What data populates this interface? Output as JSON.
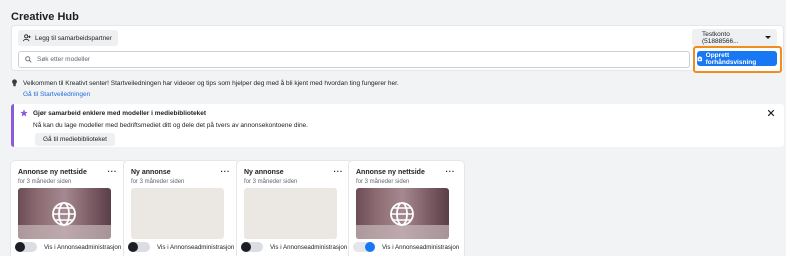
{
  "page": {
    "title": "Creative Hub"
  },
  "toolbar": {
    "partner_button": "Legg til samarbeidspartner",
    "account_select": "Testkonto (51888566...",
    "search_placeholder": "Søk etter modeller",
    "create_button": "Opprett forhåndsvisning"
  },
  "welcome": {
    "text": "Velkommen til Kreativt senter! Startveiledningen har videoer og tips som hjelper deg med å bli kjent med hvordan ting fungerer her.",
    "link": "Gå til Startveiledningen"
  },
  "banner": {
    "title": "Gjør samarbeid enklere med modeller i mediebiblioteket",
    "text": "Nå kan du lage modeller med bedriftsmediet ditt og dele det på tvers av annonsekontoene dine.",
    "button": "Gå til mediebiblioteket"
  },
  "cards": [
    {
      "title": "Annonse ny nettside",
      "subtitle": "for 3 måneder siden",
      "thumbnail": "globe-image",
      "toggle_label": "Vis i Annonseadministrasjon",
      "toggle_on": false
    },
    {
      "title": "Ny annonse",
      "subtitle": "for 3 måneder siden",
      "thumbnail": "placeholder",
      "toggle_label": "Vis i Annonseadministrasjon",
      "toggle_on": false
    },
    {
      "title": "Ny annonse",
      "subtitle": "for 3 måneder siden",
      "thumbnail": "placeholder",
      "toggle_label": "Vis i Annonseadministrasjon",
      "toggle_on": false
    },
    {
      "title": "Annonse ny nettside",
      "subtitle": "for 3 måneder siden",
      "thumbnail": "globe-image",
      "toggle_label": "Vis i Annonseadministrasjon",
      "toggle_on": true
    }
  ],
  "colors": {
    "accent": "#1877f2",
    "highlight": "#f08d1e",
    "banner_accent": "#8b5ad8"
  }
}
